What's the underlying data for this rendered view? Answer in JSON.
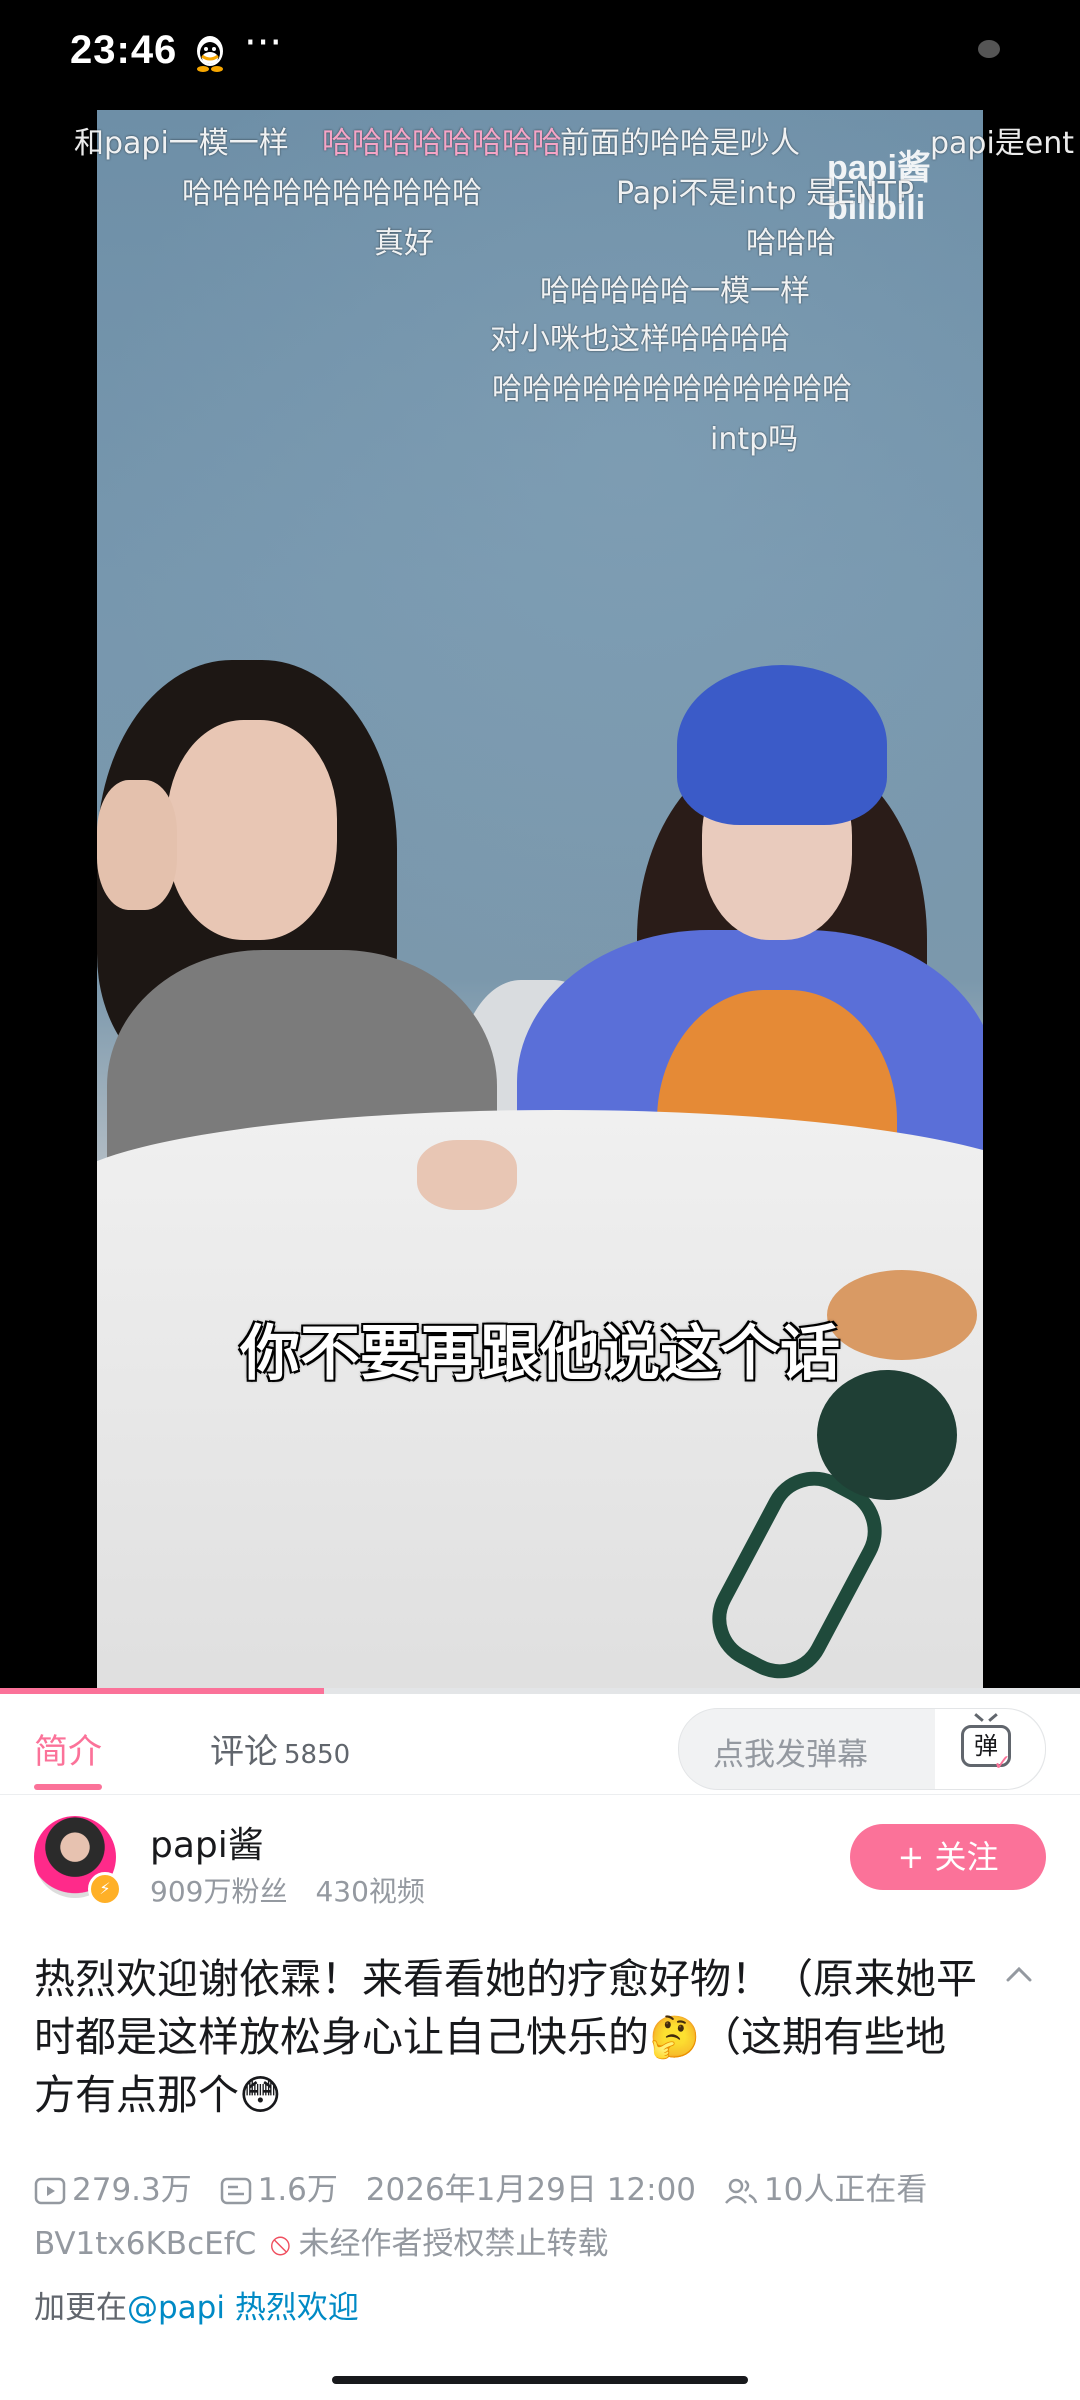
{
  "status_bar": {
    "time": "23:46",
    "more": "···"
  },
  "video": {
    "watermark": "papi酱 bilibili",
    "subtitle": "你不要再跟他说这个话",
    "danmaku": [
      {
        "text": "和papi一模一样",
        "color": "white"
      },
      {
        "text": "哈哈哈哈哈哈哈哈",
        "color": "pink"
      },
      {
        "text": "前面的哈哈是吵人",
        "color": "white"
      },
      {
        "text": "papi是ent",
        "color": "white"
      },
      {
        "text": "哈哈哈哈哈哈哈哈哈哈",
        "color": "white"
      },
      {
        "text": "Papi不是intp 是ENTP",
        "color": "white"
      },
      {
        "text": "真好",
        "color": "white"
      },
      {
        "text": "哈哈哈",
        "color": "white"
      },
      {
        "text": "哈哈哈哈哈一模一样",
        "color": "white"
      },
      {
        "text": "对小咪也这样哈哈哈哈",
        "color": "white"
      },
      {
        "text": "哈哈哈哈哈哈哈哈哈哈哈哈",
        "color": "white"
      },
      {
        "text": "intp吗",
        "color": "white"
      }
    ],
    "progress": 0.3
  },
  "tabs": {
    "intro": "简介",
    "comments": "评论",
    "comments_count": "5850"
  },
  "danmaku_input": {
    "placeholder": "点我发弹幕",
    "button_glyph": "弹"
  },
  "author": {
    "name": "papi酱",
    "followers": "909万粉丝",
    "videos": "430视频",
    "follow_label": "+ 关注"
  },
  "video_info": {
    "title": "热烈欢迎谢依霖！来看看她的疗愈好物！（原来她平时都是这样放松身心让自己快乐的🤔（这期有些地方有点那个😳",
    "views": "279.3万",
    "danmaku_count": "1.6万",
    "date": "2026年1月29日 12:00",
    "watching": "10人正在看",
    "bvid": "BV1tx6KBcEfC",
    "copyright": "未经作者授权禁止转载",
    "more_prefix": "加更在",
    "more_link": "@papi 热烈欢迎"
  },
  "colors": {
    "accent": "#fb7299",
    "link": "#008ac5",
    "muted": "#9499a0"
  }
}
